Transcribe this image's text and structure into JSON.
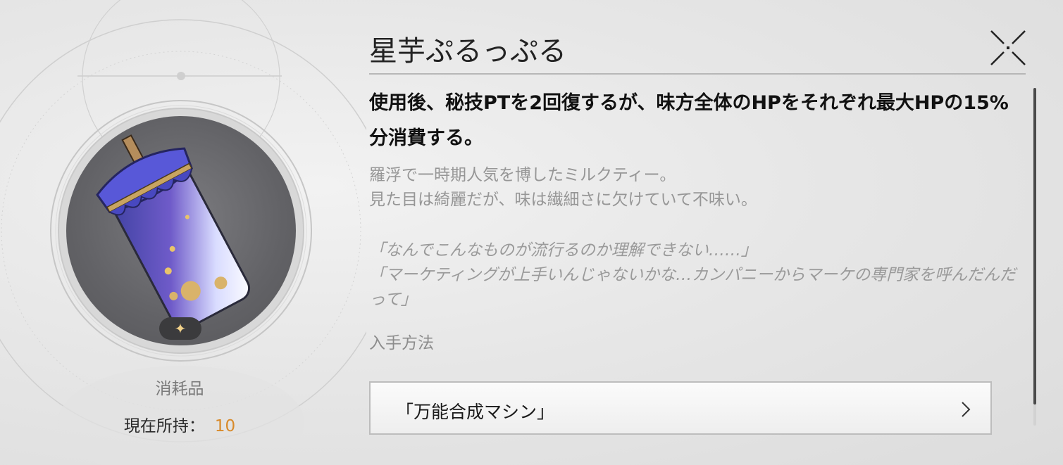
{
  "item": {
    "name": "星芋ぷるっぷる",
    "rarity_icon": "sparkle-icon",
    "category": "消耗品",
    "owned_label": "現在所持：",
    "owned_count": "10"
  },
  "description": {
    "effect": "使用後、秘技PTを2回復するが、味方全体のHPをそれぞれ最大HPの15%分消費する。",
    "flavor_lines": [
      "羅浮で一時期人気を博したミルクティー。",
      "見た目は綺麗だが、味は繊細さに欠けていて不味い。"
    ],
    "quote_lines": [
      "「なんでこんなものが流行るのか理解できない……」",
      "「マーケティングが上手いんじゃないかな…カンパニーからマーケの専門家を呼んだんだって」"
    ]
  },
  "acquisition": {
    "label": "入手方法",
    "source": "「万能合成マシン」"
  },
  "colors": {
    "accent": "#d88a2a",
    "badge": "#3b3b3d",
    "icon_bg": "#626266"
  }
}
